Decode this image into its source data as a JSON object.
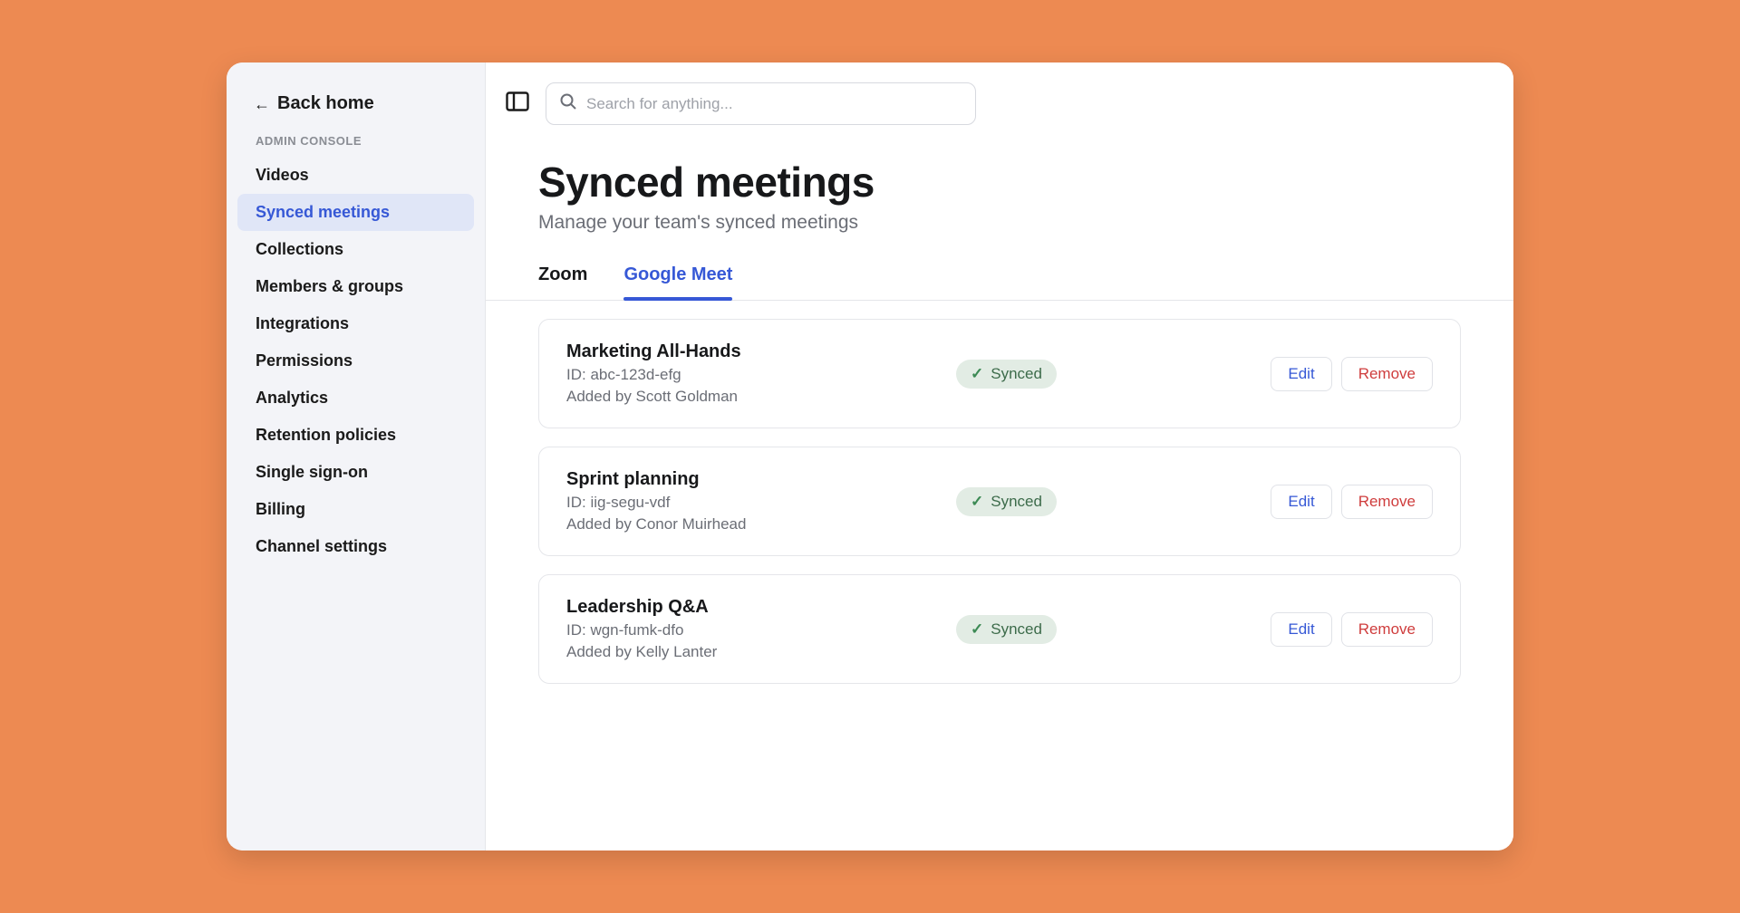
{
  "sidebar": {
    "back_label": "Back home",
    "section_label": "ADMIN CONSOLE",
    "items": [
      "Videos",
      "Synced meetings",
      "Collections",
      "Members & groups",
      "Integrations",
      "Permissions",
      "Analytics",
      "Retention policies",
      "Single sign-on",
      "Billing",
      "Channel settings"
    ],
    "active_index": 1
  },
  "search": {
    "placeholder": "Search for anything..."
  },
  "page": {
    "title": "Synced meetings",
    "subtitle": "Manage your team's synced meetings"
  },
  "tabs": {
    "items": [
      "Zoom",
      "Google Meet"
    ],
    "active_index": 1
  },
  "actions": {
    "edit": "Edit",
    "remove": "Remove"
  },
  "status": {
    "synced": "Synced"
  },
  "meetings": [
    {
      "title": "Marketing All-Hands",
      "id_line": "ID: abc-123d-efg",
      "added_by": "Added by Scott Goldman",
      "status": "synced"
    },
    {
      "title": "Sprint planning",
      "id_line": "ID: iig-segu-vdf",
      "added_by": "Added by Conor Muirhead",
      "status": "synced"
    },
    {
      "title": "Leadership Q&A",
      "id_line": "ID: wgn-fumk-dfo",
      "added_by": "Added by Kelly Lanter",
      "status": "synced"
    }
  ]
}
